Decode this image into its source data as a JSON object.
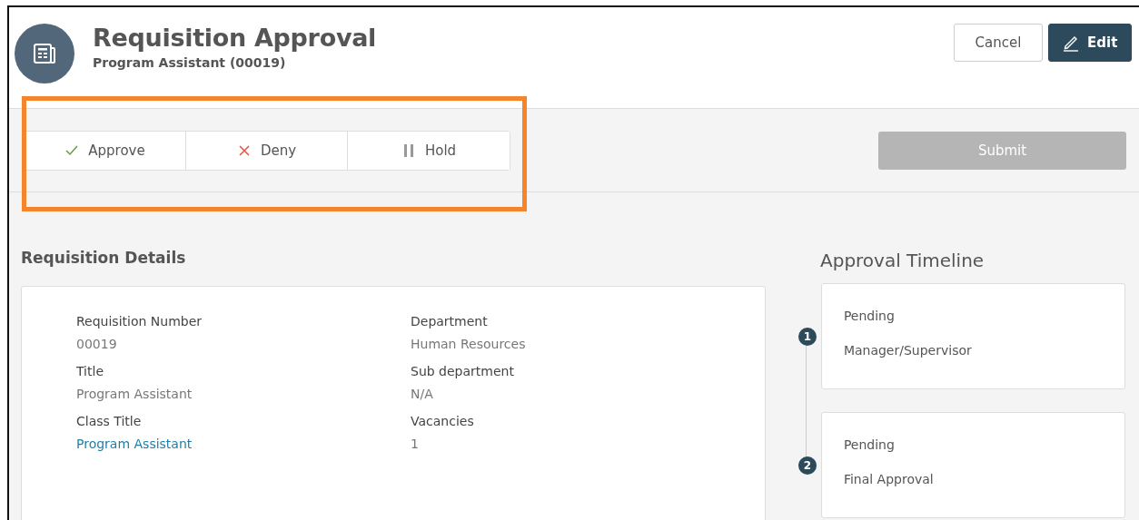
{
  "header": {
    "title": "Requisition Approval",
    "subtitle": "Program Assistant (00019)",
    "buttons": [
      {
        "label": "Cancel",
        "kind": "secondary"
      },
      {
        "label": "Edit",
        "kind": "primary"
      }
    ]
  },
  "actions": [
    {
      "label": "Approve",
      "kind": "approve",
      "selected": false
    },
    {
      "label": "Deny",
      "kind": "deny",
      "selected": false
    },
    {
      "label": "Hold",
      "kind": "hold",
      "selected": false
    }
  ],
  "submit": {
    "label": "Submit",
    "disabled": true
  },
  "details": {
    "heading": "Requisition Details",
    "fields": [
      {
        "label": "Requisition Number",
        "value": "00019",
        "link": false
      },
      {
        "label": "Department",
        "value": "Human Resources",
        "link": false
      },
      {
        "label": "Title",
        "value": "Program Assistant",
        "link": false
      },
      {
        "label": "Sub department",
        "value": "N/A",
        "link": false
      },
      {
        "label": "Class Title",
        "value": "Program Assistant",
        "link": true
      },
      {
        "label": "Vacancies",
        "value": "1",
        "link": false
      }
    ]
  },
  "timeline": {
    "heading": "Approval Timeline",
    "steps": [
      {
        "number": "1",
        "status": "Pending",
        "role": "Manager/Supervisor"
      },
      {
        "number": "2",
        "status": "Pending",
        "role": "Final Approval"
      }
    ]
  }
}
